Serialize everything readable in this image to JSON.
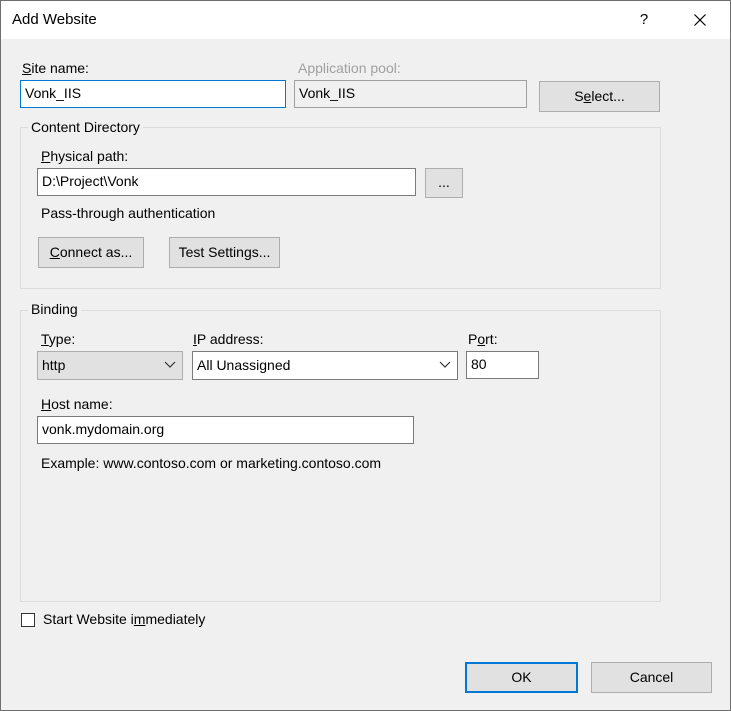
{
  "window": {
    "title": "Add Website",
    "help_glyph": "?",
    "close_icon": "close-icon"
  },
  "site": {
    "site_name_label_u": "S",
    "site_name_label_rest": "ite name:",
    "site_name_value": "Vonk_IIS",
    "app_pool_label": "Application pool:",
    "app_pool_value": "Vonk_IIS",
    "select_button_pre": "S",
    "select_button_u": "e",
    "select_button_post": "lect..."
  },
  "content_directory": {
    "title": "Content Directory",
    "physical_path_label_u": "P",
    "physical_path_label_rest": "hysical path:",
    "physical_path_value": "D:\\Project\\Vonk",
    "browse_button_label": "...",
    "auth_text": "Pass-through authentication",
    "connect_as_u": "C",
    "connect_as_rest": "onnect as...",
    "test_settings_pre": "Test Settin",
    "test_settings_u": "g",
    "test_settings_post": "s..."
  },
  "binding": {
    "title": "Binding",
    "type_label_u": "T",
    "type_label_rest": "ype:",
    "type_value": "http",
    "ip_label_u": "I",
    "ip_label_rest": "P address:",
    "ip_value": "All Unassigned",
    "port_label_pre": "P",
    "port_label_u": "o",
    "port_label_post": "rt:",
    "port_value": "80",
    "host_label_u": "H",
    "host_label_rest": "ost name:",
    "host_value": "vonk.mydomain.org",
    "example_text": "Example: www.contoso.com or marketing.contoso.com"
  },
  "start_website": {
    "label_pre": "Start Website i",
    "label_u": "m",
    "label_post": "mediately",
    "checked": false
  },
  "footer": {
    "ok_label": "OK",
    "cancel_label": "Cancel"
  },
  "colors": {
    "accent": "#0078d7",
    "dialog_bg": "#f0f0f0",
    "button_bg": "#e1e1e1",
    "disabled_text": "#a0a0a0"
  }
}
